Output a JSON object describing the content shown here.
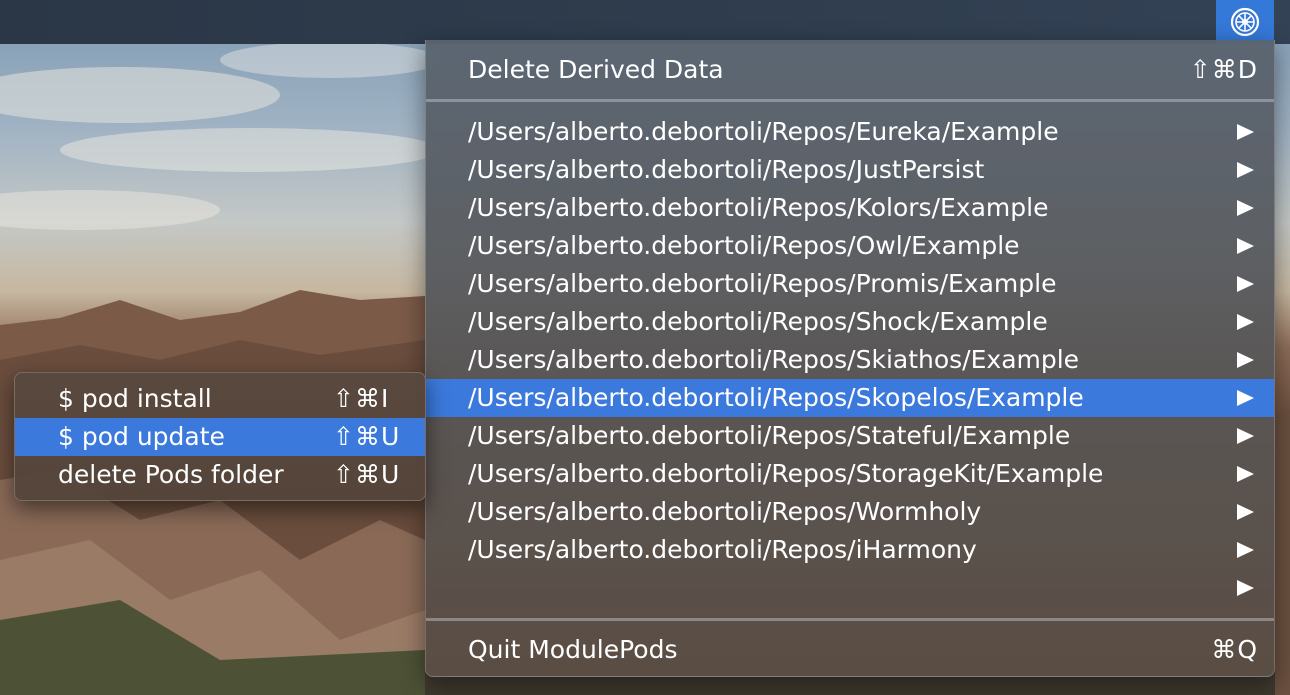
{
  "menubar": {
    "status_icon": "helm-wheel-icon",
    "accent_color": "#3478d8"
  },
  "main_menu": {
    "delete_derived_data": {
      "label": "Delete Derived Data",
      "shortcut": "⇧⌘D"
    },
    "repos": [
      {
        "path": "/Users/alberto.debortoli/Repos/Eureka/Example"
      },
      {
        "path": "/Users/alberto.debortoli/Repos/JustPersist"
      },
      {
        "path": "/Users/alberto.debortoli/Repos/Kolors/Example"
      },
      {
        "path": "/Users/alberto.debortoli/Repos/Owl/Example"
      },
      {
        "path": "/Users/alberto.debortoli/Repos/Promis/Example"
      },
      {
        "path": "/Users/alberto.debortoli/Repos/Shock/Example"
      },
      {
        "path": "/Users/alberto.debortoli/Repos/Skiathos/Example"
      },
      {
        "path": "/Users/alberto.debortoli/Repos/Skopelos/Example"
      },
      {
        "path": "/Users/alberto.debortoli/Repos/Stateful/Example"
      },
      {
        "path": "/Users/alberto.debortoli/Repos/StorageKit/Example"
      },
      {
        "path": "/Users/alberto.debortoli/Repos/Wormholy"
      },
      {
        "path": "/Users/alberto.debortoli/Repos/iHarmony"
      },
      {
        "path": ""
      }
    ],
    "highlighted_repo_index": 7,
    "quit": {
      "label": "Quit ModulePods",
      "shortcut": "⌘Q"
    },
    "highlight_color": "#3b79dc"
  },
  "submenu": {
    "items": [
      {
        "label": "$ pod install",
        "shortcut": "⇧⌘I"
      },
      {
        "label": "$ pod update",
        "shortcut": "⇧⌘U"
      },
      {
        "label": "delete Pods folder",
        "shortcut": "⇧⌘U"
      }
    ],
    "highlighted_index": 1
  }
}
